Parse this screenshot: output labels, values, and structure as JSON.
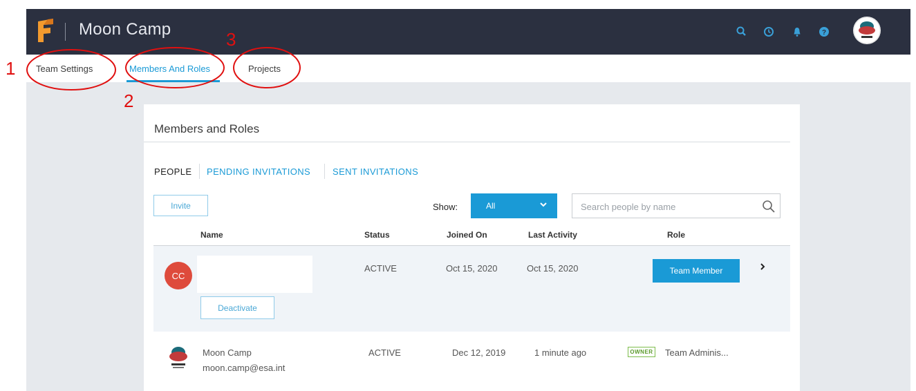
{
  "app": {
    "title": "Moon Camp",
    "accent_color": "#1a9ad6",
    "topbar_color": "#2b3040"
  },
  "topbar": {
    "icons": [
      "search-icon",
      "clock-icon",
      "bell-icon",
      "help-icon",
      "user-avatar"
    ]
  },
  "tabs": [
    {
      "label": "Team Settings",
      "active": false
    },
    {
      "label": "Members And Roles",
      "active": true
    },
    {
      "label": "Projects",
      "active": false
    }
  ],
  "annotations": [
    "1",
    "2",
    "3"
  ],
  "card": {
    "title": "Members and Roles",
    "subtabs": [
      {
        "label": "PEOPLE",
        "active": true
      },
      {
        "label": "PENDING INVITATIONS",
        "active": false
      },
      {
        "label": "SENT INVITATIONS",
        "active": false
      }
    ],
    "invite_label": "Invite",
    "show_label": "Show:",
    "show_value": "All",
    "search_placeholder": "Search people by name",
    "columns": [
      "Name",
      "Status",
      "Joined On",
      "Last Activity",
      "Role"
    ],
    "rows": [
      {
        "initials": "CC",
        "status": "ACTIVE",
        "joined": "Oct 15, 2020",
        "last_activity": "Oct 15, 2020",
        "role": "Team Member",
        "deactivate_label": "Deactivate"
      },
      {
        "name": "Moon Camp",
        "email": "moon.camp@esa.int",
        "status": "ACTIVE",
        "joined": "Dec 12, 2019",
        "last_activity": "1 minute ago",
        "badge": "OWNER",
        "role": "Team Adminis..."
      }
    ]
  }
}
